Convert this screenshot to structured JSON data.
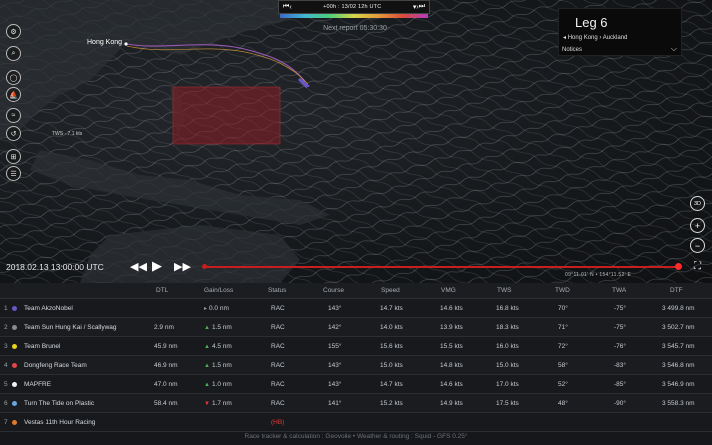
{
  "timebar": {
    "label": "+00h : 13/02 12h UTC",
    "first_icon": "skip-back-icon",
    "prev_icon": "step-back-icon",
    "menu_icon": "dropdown-icon",
    "next_icon": "step-forward-icon",
    "last_icon": "skip-forward-icon"
  },
  "next_report": "Next report 05:30:30",
  "leg": {
    "title": "Leg 6",
    "route": "Hong Kong › Auckland",
    "notices": "Notices"
  },
  "map": {
    "port_label": "Hong Kong",
    "scale_label": "TWS · 7.1 kts",
    "coords": "09°11.01' N • 154°11.52' E"
  },
  "playback": {
    "date": "2018.02.13 13:00:00 UTC"
  },
  "right_tools": {
    "view3d": "3D",
    "zoom_in": "+",
    "zoom_out": "−",
    "fullscreen": "⛶"
  },
  "table": {
    "columns": [
      "DTL",
      "Gain/Loss",
      "Status",
      "Course",
      "Speed",
      "VMG",
      "TWS",
      "TWD",
      "TWA",
      "DTF"
    ],
    "rows": [
      {
        "rank": "1",
        "color": "#6b56c9",
        "name": "Team AkzoNobel",
        "dtl": "",
        "gain_dir": "none",
        "gain": "0.0 nm",
        "status": "RAC",
        "course": "143°",
        "speed": "14.7 kts",
        "vmg": "14.6 kts",
        "tws": "16.8 kts",
        "twd": "70°",
        "twa": "-75°",
        "dtf": "3 499.8 nm"
      },
      {
        "rank": "2",
        "color": "#8c8c8c",
        "name": "Team Sun Hung Kai / Scallywag",
        "dtl": "2.9 nm",
        "gain_dir": "up",
        "gain": "1.5 nm",
        "status": "RAC",
        "course": "142°",
        "speed": "14.0 kts",
        "vmg": "13.9 kts",
        "tws": "18.3 kts",
        "twd": "71°",
        "twa": "-75°",
        "dtf": "3 502.7 nm"
      },
      {
        "rank": "3",
        "color": "#e8d21c",
        "name": "Team Brunel",
        "dtl": "45.9 nm",
        "gain_dir": "up",
        "gain": "4.5 nm",
        "status": "RAC",
        "course": "155°",
        "speed": "15.6 kts",
        "vmg": "15.5 kts",
        "tws": "16.0 kts",
        "twd": "72°",
        "twa": "-76°",
        "dtf": "3 545.7 nm"
      },
      {
        "rank": "4",
        "color": "#e2474b",
        "name": "Dongfeng Race Team",
        "dtl": "46.9 nm",
        "gain_dir": "up",
        "gain": "1.5 nm",
        "status": "RAC",
        "course": "143°",
        "speed": "15.0 kts",
        "vmg": "14.8 kts",
        "tws": "15.0 kts",
        "twd": "58°",
        "twa": "-83°",
        "dtf": "3 546.8 nm"
      },
      {
        "rank": "5",
        "color": "#f2f2f2",
        "name": "MAPFRE",
        "dtl": "47.0 nm",
        "gain_dir": "up",
        "gain": "1.0 nm",
        "status": "RAC",
        "course": "143°",
        "speed": "14.7 kts",
        "vmg": "14.6 kts",
        "tws": "17.0 kts",
        "twd": "52°",
        "twa": "-85°",
        "dtf": "3 546.9 nm"
      },
      {
        "rank": "6",
        "color": "#6aa6e0",
        "name": "Turn The Tide on Plastic",
        "dtl": "58.4 nm",
        "gain_dir": "down",
        "gain": "1.7 nm",
        "status": "RAC",
        "course": "141°",
        "speed": "15.2 kts",
        "vmg": "14.9 kts",
        "tws": "17.5 kts",
        "twd": "48°",
        "twa": "-90°",
        "dtf": "3 558.3 nm"
      },
      {
        "rank": "7",
        "color": "#e07a2a",
        "name": "Vestas 11th Hour Racing",
        "dtl": "",
        "gain_dir": "none_empty",
        "gain": "",
        "status": "(HB)",
        "course": "",
        "speed": "",
        "vmg": "",
        "tws": "",
        "twd": "",
        "twa": "",
        "dtf": ""
      }
    ]
  },
  "footer": "Race tracker & calculation : Geovoile • Weather & routing : Squid - GFS 0.25°",
  "colors": {
    "track": "#c81e1e",
    "zone": "#8a1e24",
    "route": "#9b59b6"
  }
}
